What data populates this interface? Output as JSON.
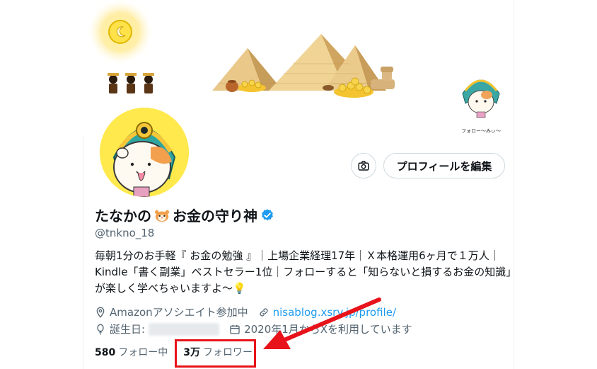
{
  "profile": {
    "display_name": "たなかの",
    "display_name_suffix": "お金の守り神",
    "handle": "@tnkno_18",
    "bio": "毎朝1分のお手軽『 お金の勉強 』｜上場企業経理17年｜Ｘ本格運用6ヶ月で１万人｜Kindle「書く副業」ベストセラー1位｜フォローすると「知らないと損するお金の知識」が楽しく学べちゃいますよ～💡",
    "location": "Amazonアソシエイト参加中",
    "website": "nisablog.xsrv.jp/profile/",
    "birthday_label": "誕生日:",
    "joined": "2020年1月からXを利用しています"
  },
  "buttons": {
    "edit_profile": "プロフィールを編集"
  },
  "stats": {
    "following_count": "580",
    "following_label": "フォロー中",
    "followers_count": "3万",
    "followers_label": "フォロワー"
  },
  "banner": {
    "sticker_caption": "フォロー〜みぃ〜"
  },
  "icons": {
    "verified": "verified-badge-icon",
    "location": "location-pin-icon",
    "link": "link-icon",
    "birthday": "balloon-icon",
    "calendar": "calendar-icon",
    "camera": "camera-icon"
  },
  "colors": {
    "accent": "#1d9bf0",
    "highlight": "#e8131a"
  }
}
